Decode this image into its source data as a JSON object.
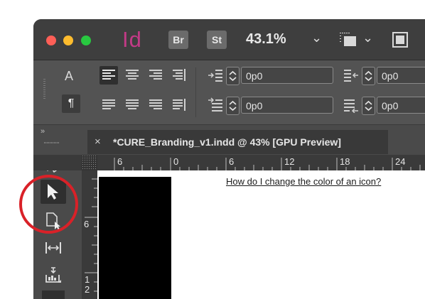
{
  "app": {
    "logo_text": "Id",
    "bridge_badge": "Br",
    "stock_badge": "St",
    "zoom_level": "43.1%",
    "colors": {
      "close": "#fe5f57",
      "minimize": "#febc2e",
      "maximize": "#28c840",
      "logo": "#c23a86"
    }
  },
  "controls": {
    "char_mode": "A",
    "para_mode": "¶",
    "left_indent": "0p0",
    "first_line_indent": "0p0",
    "right_indent": "0p0",
    "last_line_indent": "0p0"
  },
  "toolbar": {
    "collapse": "»",
    "tools": [
      {
        "name": "direct-selection-icon"
      },
      {
        "name": "selection-icon",
        "selected": true
      },
      {
        "name": "page-tool-icon"
      },
      {
        "name": "gap-tool-icon"
      },
      {
        "name": "content-collector-icon"
      }
    ]
  },
  "document": {
    "tab_close": "×",
    "tab_title": "*CURE_Branding_v1.indd @ 43% [GPU Preview]"
  },
  "ruler": {
    "h_labels": [
      "6",
      "0",
      "6",
      "12",
      "18",
      "24"
    ],
    "v_labels": [
      "6",
      "1",
      "2"
    ]
  },
  "annotation": {
    "caption": "How do I change the color of an icon?",
    "circle_color": "#d92128"
  }
}
